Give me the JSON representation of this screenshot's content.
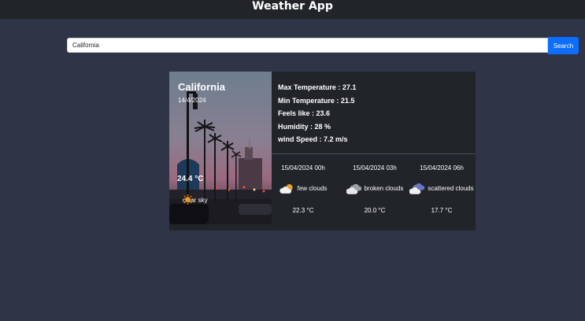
{
  "header": {
    "title": "Weather App"
  },
  "search": {
    "value": "California",
    "button_label": "Search"
  },
  "current": {
    "city": "California",
    "date": "14/4/2024",
    "temperature": "24.4 °C",
    "condition": "clear sky",
    "condition_icon": "sun-icon",
    "stats": [
      "Max Temperature : 27.1",
      "Min Temperature : 21.5",
      "Feels like : 23.6",
      "Humidity : 28 %",
      "wind Speed : 7.2 m/s"
    ]
  },
  "forecast": [
    {
      "time": "15/04/2024 00h",
      "icon": "few-clouds-icon",
      "description": "few clouds",
      "temperature": "22.3 °C"
    },
    {
      "time": "15/04/2024 03h",
      "icon": "broken-clouds-icon",
      "description": "broken clouds",
      "temperature": "20.0 °C"
    },
    {
      "time": "15/04/2024 06h",
      "icon": "scattered-clouds-icon",
      "description": "scattered clouds",
      "temperature": "17.7 °C"
    }
  ],
  "colors": {
    "background": "#2f3446",
    "topbar": "#212529",
    "card": "#212529",
    "accent": "#0d6efd"
  }
}
